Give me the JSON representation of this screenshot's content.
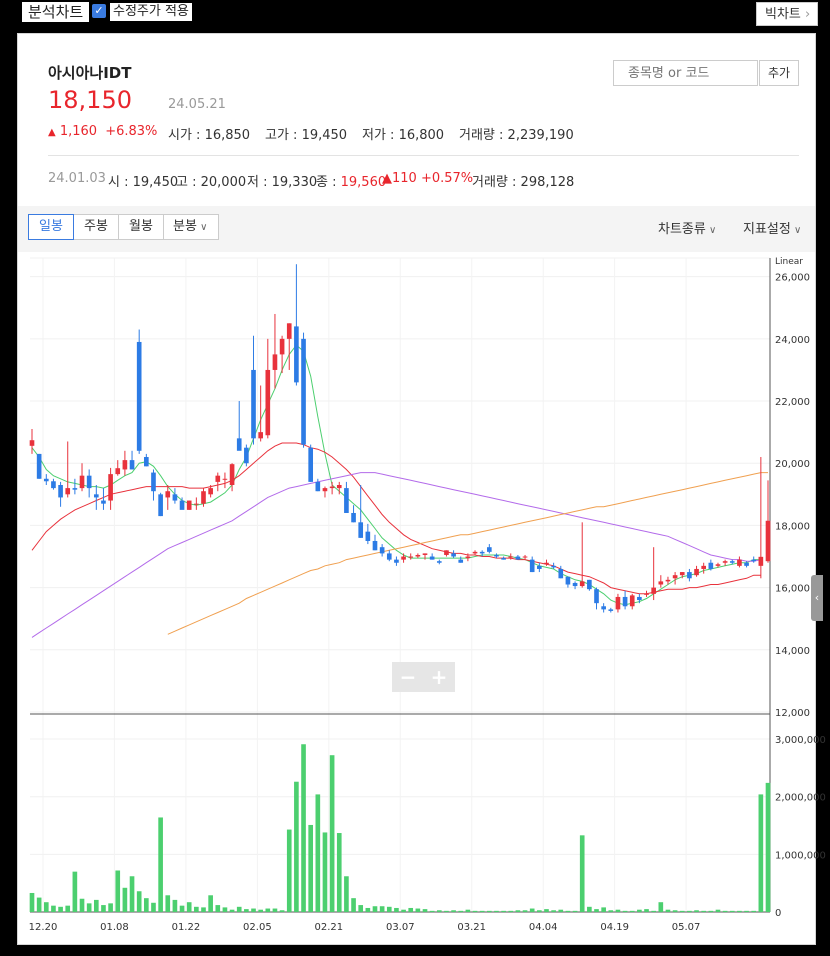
{
  "header": {
    "title": "분석차트",
    "checkbox_label": "수정주가 적용",
    "checkbox_checked": true,
    "top_button": "빅차트",
    "top_button_icon": "chevron-right-icon"
  },
  "stock": {
    "name": "아시아나IDT",
    "price": "18,150",
    "date": "24.05.21",
    "change_arrow": "▲",
    "change": "1,160",
    "change_pct": "+6.83%",
    "open_label": "시가",
    "open": "16,850",
    "high_label": "고가",
    "high": "19,450",
    "low_label": "저가",
    "low": "16,800",
    "volume_label": "거래량",
    "volume": "2,239,190"
  },
  "search": {
    "placeholder": "종목명 or 코드",
    "button": "추가"
  },
  "day_info": {
    "date": "24.01.03",
    "open_label": "시",
    "open": "19,450",
    "high_label": "고",
    "high": "20,000",
    "low_label": "저",
    "low": "19,330",
    "close_label": "종",
    "close": "19,560",
    "change_arrow": "▲",
    "change": "110",
    "change_pct": "+0.57%",
    "volume_label": "거래량",
    "volume": "298,128"
  },
  "toolbar": {
    "tabs": [
      {
        "label": "일봉",
        "active": true
      },
      {
        "label": "주봉"
      },
      {
        "label": "월봉"
      },
      {
        "label": "분봉"
      }
    ],
    "chart_type": "차트종류",
    "indicator": "지표설정"
  },
  "colors": {
    "up": "#e8323c",
    "down": "#2c7be5",
    "volume": "#4ccf6f",
    "ma5": "#4ccf6f",
    "ma20": "#e8323c",
    "ma60": "#b36bea",
    "ma120": "#f0a050"
  },
  "chart_data": {
    "type": "candlestick",
    "scale": "Linear",
    "price_ticks": [
      "12,000",
      "14,000",
      "16,000",
      "18,000",
      "20,000",
      "22,000",
      "24,000",
      "26,000"
    ],
    "volume_ticks": [
      "0",
      "1,000,000",
      "2,000,000",
      "3,000,000"
    ],
    "x_ticks": [
      "12.20",
      "01.08",
      "01.22",
      "02.05",
      "02.21",
      "03.07",
      "03.21",
      "04.04",
      "04.19",
      "05.07"
    ],
    "ylim_price": [
      12000,
      26600
    ],
    "ylim_volume": [
      0,
      3400000
    ],
    "candles": [
      [
        20560,
        21100,
        20300,
        20740
      ],
      [
        20300,
        20300,
        19500,
        19500
      ],
      [
        19500,
        19650,
        19300,
        19420
      ],
      [
        19420,
        19500,
        19150,
        19200
      ],
      [
        19300,
        19400,
        18600,
        18900
      ],
      [
        19000,
        20700,
        18900,
        19200
      ],
      [
        19200,
        19500,
        19000,
        19150
      ],
      [
        19200,
        20000,
        19100,
        19600
      ],
      [
        19600,
        19800,
        18900,
        19200
      ],
      [
        19000,
        19300,
        18500,
        18900
      ],
      [
        18800,
        19200,
        18500,
        18700
      ],
      [
        18800,
        19850,
        18500,
        19650
      ],
      [
        19650,
        20100,
        19600,
        19840
      ],
      [
        19800,
        20400,
        19600,
        20100
      ],
      [
        20100,
        20400,
        19800,
        19800
      ],
      [
        23900,
        24300,
        20300,
        20400
      ],
      [
        20200,
        20300,
        19900,
        19900
      ],
      [
        19700,
        19800,
        18800,
        19100
      ],
      [
        19000,
        19050,
        18300,
        18300
      ],
      [
        18900,
        19300,
        18500,
        19100
      ],
      [
        19000,
        19200,
        18700,
        18800
      ],
      [
        18800,
        18900,
        18600,
        18500
      ],
      [
        18500,
        18800,
        18500,
        18800
      ],
      [
        18700,
        18900,
        18500,
        18700
      ],
      [
        18700,
        19200,
        18600,
        19100
      ],
      [
        19000,
        19300,
        18900,
        19200
      ],
      [
        19400,
        19700,
        19100,
        19600
      ],
      [
        19500,
        19700,
        19200,
        19500
      ],
      [
        19300,
        20000,
        19100,
        19970
      ],
      [
        20800,
        22000,
        20600,
        20400
      ],
      [
        20500,
        20600,
        19900,
        20000
      ],
      [
        23000,
        24100,
        20600,
        20800
      ],
      [
        20800,
        22500,
        20700,
        21000
      ],
      [
        20900,
        24000,
        20800,
        23000
      ],
      [
        23000,
        24800,
        22400,
        23500
      ],
      [
        23500,
        24100,
        22900,
        24000
      ],
      [
        24000,
        24500,
        23000,
        24500
      ],
      [
        24400,
        26400,
        22500,
        22600
      ],
      [
        24000,
        24200,
        20500,
        20600
      ],
      [
        20500,
        20600,
        19400,
        19400
      ],
      [
        19400,
        19500,
        19100,
        19100
      ],
      [
        19100,
        19250,
        18900,
        19200
      ],
      [
        19200,
        19400,
        19000,
        19250
      ],
      [
        19200,
        19400,
        19000,
        19300
      ],
      [
        19200,
        19400,
        18700,
        18400
      ],
      [
        18400,
        18650,
        18100,
        18100
      ],
      [
        18100,
        19300,
        17600,
        17600
      ],
      [
        17800,
        18050,
        17400,
        17500
      ],
      [
        17500,
        17700,
        17200,
        17200
      ],
      [
        17300,
        17400,
        17000,
        17100
      ],
      [
        17100,
        17200,
        16850,
        16900
      ],
      [
        16900,
        17000,
        16700,
        16800
      ],
      [
        16900,
        17100,
        16800,
        17000
      ],
      [
        17000,
        17100,
        16900,
        17000
      ],
      [
        17000,
        17100,
        16950,
        17050
      ],
      [
        17050,
        17100,
        16900,
        17100
      ],
      [
        17000,
        17100,
        16900,
        16900
      ],
      [
        16850,
        16900,
        16750,
        16800
      ],
      [
        17050,
        17200,
        17000,
        17200
      ],
      [
        17100,
        17200,
        16950,
        17000
      ],
      [
        16900,
        17000,
        16800,
        16800
      ],
      [
        16950,
        17100,
        16850,
        17000
      ],
      [
        17100,
        17200,
        17050,
        17150
      ],
      [
        17150,
        17200,
        17000,
        17100
      ],
      [
        17300,
        17400,
        17100,
        17150
      ],
      [
        17050,
        17100,
        16950,
        17000
      ],
      [
        16950,
        17000,
        16900,
        16900
      ],
      [
        17000,
        17100,
        16900,
        17000
      ],
      [
        17000,
        17050,
        16900,
        16900
      ],
      [
        17000,
        17050,
        16900,
        17000
      ],
      [
        16900,
        17000,
        16500,
        16500
      ],
      [
        16700,
        16800,
        16500,
        16600
      ],
      [
        16750,
        16900,
        16700,
        16800
      ],
      [
        16700,
        16800,
        16600,
        16650
      ],
      [
        16600,
        16700,
        16300,
        16300
      ],
      [
        16350,
        16350,
        16000,
        16100
      ],
      [
        16150,
        16200,
        15950,
        16050
      ],
      [
        16050,
        18100,
        16000,
        16200
      ],
      [
        16250,
        16250,
        15900,
        15950
      ],
      [
        15950,
        16000,
        15300,
        15500
      ],
      [
        15400,
        15500,
        15200,
        15300
      ],
      [
        15300,
        15350,
        15200,
        15250
      ],
      [
        15300,
        15800,
        15200,
        15700
      ],
      [
        15700,
        15900,
        15300,
        15400
      ],
      [
        15400,
        15800,
        15300,
        15750
      ],
      [
        15700,
        15800,
        15500,
        15600
      ],
      [
        15800,
        15900,
        15700,
        15800
      ],
      [
        15800,
        17300,
        15600,
        16000
      ],
      [
        16100,
        16400,
        16000,
        16200
      ],
      [
        16200,
        16350,
        16100,
        16250
      ],
      [
        16300,
        16500,
        16100,
        16400
      ],
      [
        16400,
        16500,
        16300,
        16500
      ],
      [
        16500,
        16600,
        16200,
        16300
      ],
      [
        16400,
        16700,
        16350,
        16600
      ],
      [
        16600,
        16800,
        16450,
        16700
      ],
      [
        16800,
        16900,
        16550,
        16600
      ],
      [
        16700,
        16800,
        16650,
        16750
      ],
      [
        16800,
        16900,
        16700,
        16850
      ],
      [
        16850,
        16900,
        16750,
        16800
      ],
      [
        16700,
        17000,
        16650,
        16900
      ],
      [
        16800,
        16850,
        16650,
        16700
      ],
      [
        16900,
        17000,
        16800,
        16850
      ],
      [
        16700,
        20200,
        16300,
        16990
      ],
      [
        16850,
        19450,
        16800,
        18150
      ]
    ],
    "volumes": [
      330000,
      250000,
      170000,
      110000,
      90000,
      110000,
      700000,
      230000,
      150000,
      210000,
      120000,
      150000,
      720000,
      420000,
      620000,
      360000,
      240000,
      160000,
      1640000,
      290000,
      210000,
      110000,
      170000,
      90000,
      80000,
      290000,
      120000,
      80000,
      40000,
      90000,
      50000,
      60000,
      40000,
      60000,
      60000,
      30000,
      1430000,
      2260000,
      2910000,
      1510000,
      2040000,
      1380000,
      2720000,
      1370000,
      620000,
      240000,
      120000,
      70000,
      100000,
      100000,
      90000,
      70000,
      40000,
      70000,
      60000,
      50000,
      20000,
      30000,
      20000,
      30000,
      20000,
      40000,
      20000,
      20000,
      20000,
      20000,
      20000,
      20000,
      30000,
      30000,
      60000,
      30000,
      50000,
      30000,
      40000,
      20000,
      20000,
      1330000,
      90000,
      50000,
      80000,
      30000,
      40000,
      20000,
      20000,
      40000,
      50000,
      20000,
      170000,
      40000,
      30000,
      20000,
      20000,
      30000,
      20000,
      20000,
      40000,
      20000,
      20000,
      20000,
      20000,
      20000,
      2040000,
      2240000
    ],
    "ma_lines": [
      {
        "key": "ma5",
        "start": 0,
        "values": [
          20500,
          20200,
          19800,
          19600,
          19500,
          19400,
          19350,
          19300,
          19250,
          19250,
          19200,
          19300,
          19450,
          19600,
          19700,
          20000,
          20050,
          19900,
          19600,
          19250,
          19000,
          18800,
          18700,
          18650,
          18700,
          18750,
          18900,
          19050,
          19300,
          19800,
          20200,
          20800,
          21400,
          21900,
          22400,
          23000,
          23500,
          23800,
          23600,
          22800,
          21500,
          20300,
          19300,
          19100,
          18900,
          18700,
          18500,
          18200,
          17900,
          17600,
          17400,
          17200,
          17050,
          16950,
          16950,
          16950,
          16950,
          16950,
          16950,
          16950,
          16950,
          16950,
          17000,
          17050,
          17050,
          17050,
          17050,
          17000,
          16950,
          16900,
          16800,
          16700,
          16650,
          16600,
          16450,
          16350,
          16250,
          16200,
          16100,
          15950,
          15800,
          15600,
          15500,
          15450,
          15500,
          15550,
          15650,
          15800,
          15950,
          16100,
          16250,
          16350,
          16400,
          16450,
          16550,
          16600,
          16650,
          16700,
          16750,
          16800,
          16800,
          16900,
          16900
        ]
      },
      {
        "key": "ma20",
        "start": 0,
        "values": [
          17200,
          17500,
          17800,
          18000,
          18200,
          18350,
          18500,
          18600,
          18700,
          18800,
          18900,
          19000,
          19050,
          19100,
          19150,
          19200,
          19250,
          19250,
          19250,
          19250,
          19250,
          19250,
          19200,
          19200,
          19200,
          19250,
          19300,
          19350,
          19450,
          19600,
          19800,
          20000,
          20200,
          20400,
          20550,
          20650,
          20650,
          20650,
          20600,
          20500,
          20450,
          20350,
          20200,
          20000,
          19800,
          19550,
          19250,
          18950,
          18650,
          18350,
          18100,
          17900,
          17700,
          17550,
          17450,
          17350,
          17250,
          17200,
          17150,
          17100,
          17100,
          17050,
          17050,
          17000,
          17000,
          16950,
          16950,
          16950,
          16900,
          16900,
          16850,
          16800,
          16750,
          16700,
          16600,
          16500,
          16450,
          16400,
          16350,
          16250,
          16150,
          16000,
          15950,
          15900,
          15850,
          15800,
          15800,
          15850,
          15900,
          15950,
          15950,
          15950,
          16000,
          16000,
          16050,
          16100,
          16100,
          16150,
          16200,
          16250,
          16300,
          16400,
          16400
        ]
      },
      {
        "key": "ma60",
        "start": 0,
        "values": [
          14400,
          14550,
          14700,
          14850,
          15000,
          15150,
          15300,
          15450,
          15600,
          15750,
          15900,
          16050,
          16200,
          16350,
          16500,
          16650,
          16800,
          16950,
          17100,
          17250,
          17350,
          17450,
          17550,
          17650,
          17750,
          17850,
          17950,
          18050,
          18150,
          18300,
          18450,
          18600,
          18750,
          18900,
          19000,
          19100,
          19200,
          19250,
          19300,
          19350,
          19400,
          19450,
          19500,
          19550,
          19600,
          19650,
          19700,
          19700,
          19700,
          19650,
          19600,
          19550,
          19500,
          19450,
          19400,
          19350,
          19300,
          19250,
          19200,
          19150,
          19100,
          19050,
          19000,
          18950,
          18900,
          18850,
          18800,
          18750,
          18700,
          18650,
          18600,
          18550,
          18500,
          18450,
          18400,
          18350,
          18300,
          18250,
          18200,
          18150,
          18100,
          18050,
          18000,
          17950,
          17900,
          17850,
          17800,
          17750,
          17700,
          17650,
          17550,
          17450,
          17350,
          17250,
          17150,
          17050,
          17000,
          16950,
          16900,
          16900,
          16850,
          16850,
          16900
        ]
      },
      {
        "key": "ma120",
        "start": 19,
        "values": [
          14500,
          14600,
          14700,
          14800,
          14900,
          15000,
          15100,
          15200,
          15300,
          15400,
          15500,
          15650,
          15750,
          15850,
          15950,
          16050,
          16150,
          16250,
          16350,
          16450,
          16550,
          16600,
          16700,
          16750,
          16800,
          16900,
          16950,
          17000,
          17050,
          17100,
          17150,
          17200,
          17250,
          17300,
          17350,
          17400,
          17450,
          17500,
          17550,
          17600,
          17650,
          17700,
          17700,
          17750,
          17800,
          17850,
          17900,
          17950,
          18000,
          18050,
          18100,
          18150,
          18200,
          18250,
          18300,
          18350,
          18400,
          18450,
          18500,
          18550,
          18600,
          18600,
          18650,
          18700,
          18750,
          18800,
          18850,
          18900,
          18950,
          19000,
          19050,
          19100,
          19150,
          19200,
          19250,
          19300,
          19350,
          19400,
          19450,
          19500,
          19550,
          19600,
          19650,
          19700,
          19700
        ]
      }
    ]
  }
}
